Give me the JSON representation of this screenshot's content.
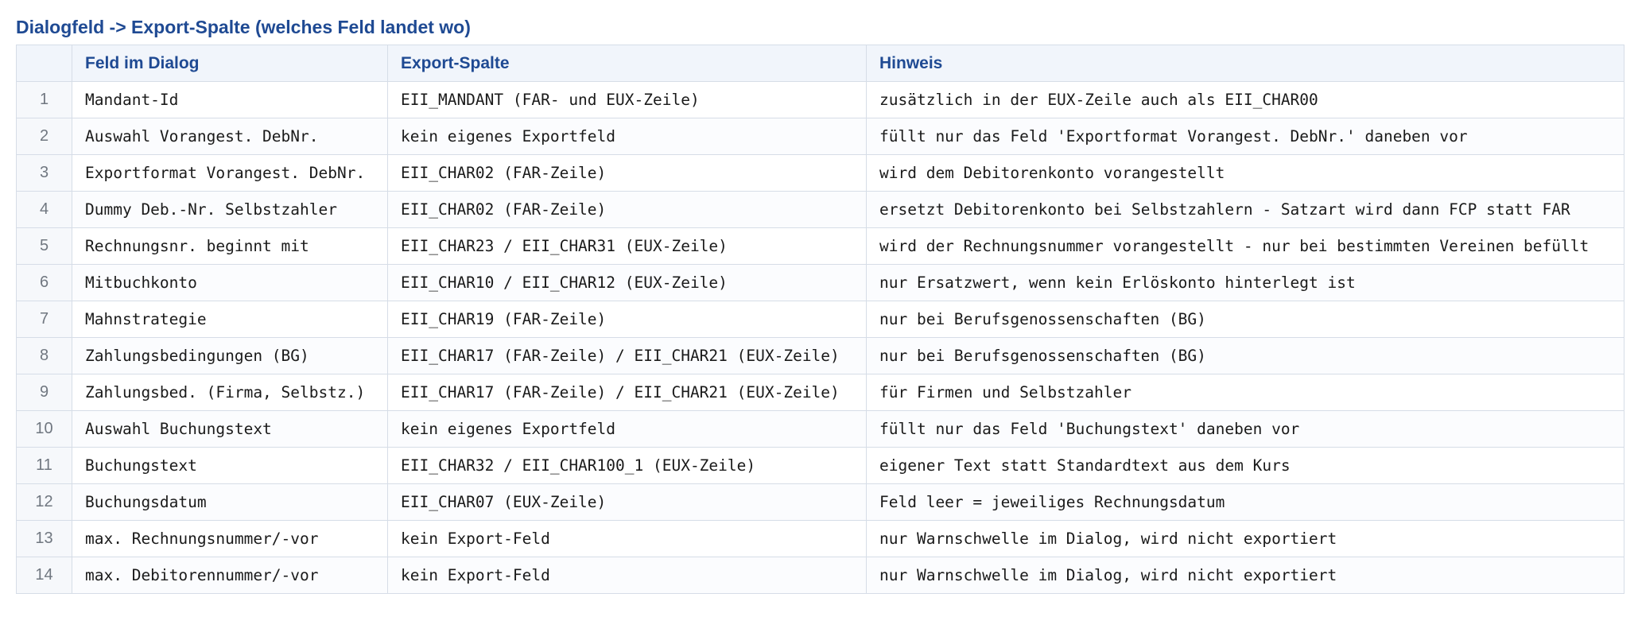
{
  "title": "Dialogfeld -> Export-Spalte (welches Feld landet wo)",
  "columns": [
    "",
    "Feld im Dialog",
    "Export-Spalte",
    "Hinweis"
  ],
  "rows": [
    {
      "num": "1",
      "field": "Mandant-Id",
      "export": "EII_MANDANT (FAR- und EUX-Zeile)",
      "note": "zusätzlich in der EUX-Zeile auch als EII_CHAR00"
    },
    {
      "num": "2",
      "field": "Auswahl Vorangest. DebNr.",
      "export": "kein eigenes Exportfeld",
      "note": "füllt nur das Feld 'Exportformat Vorangest. DebNr.' daneben vor"
    },
    {
      "num": "3",
      "field": "Exportformat Vorangest. DebNr.",
      "export": "EII_CHAR02 (FAR-Zeile)",
      "note": "wird dem Debitorenkonto vorangestellt"
    },
    {
      "num": "4",
      "field": "Dummy Deb.-Nr. Selbstzahler",
      "export": "EII_CHAR02 (FAR-Zeile)",
      "note": "ersetzt Debitorenkonto bei Selbstzahlern - Satzart wird dann FCP statt FAR"
    },
    {
      "num": "5",
      "field": "Rechnungsnr. beginnt mit",
      "export": "EII_CHAR23 / EII_CHAR31 (EUX-Zeile)",
      "note": "wird der Rechnungsnummer vorangestellt - nur bei bestimmten Vereinen befüllt"
    },
    {
      "num": "6",
      "field": "Mitbuchkonto",
      "export": "EII_CHAR10 / EII_CHAR12 (EUX-Zeile)",
      "note": "nur Ersatzwert, wenn kein Erlöskonto hinterlegt ist"
    },
    {
      "num": "7",
      "field": "Mahnstrategie",
      "export": "EII_CHAR19 (FAR-Zeile)",
      "note": "nur bei Berufsgenossenschaften (BG)"
    },
    {
      "num": "8",
      "field": "Zahlungsbedingungen (BG)",
      "export": "EII_CHAR17 (FAR-Zeile) / EII_CHAR21 (EUX-Zeile)",
      "note": "nur bei Berufsgenossenschaften (BG)"
    },
    {
      "num": "9",
      "field": "Zahlungsbed. (Firma, Selbstz.)",
      "export": "EII_CHAR17 (FAR-Zeile) / EII_CHAR21 (EUX-Zeile)",
      "note": "für Firmen und Selbstzahler"
    },
    {
      "num": "10",
      "field": "Auswahl Buchungstext",
      "export": "kein eigenes Exportfeld",
      "note": "füllt nur das Feld 'Buchungstext' daneben vor"
    },
    {
      "num": "11",
      "field": "Buchungstext",
      "export": "EII_CHAR32 / EII_CHAR100_1 (EUX-Zeile)",
      "note": "eigener Text statt Standardtext aus dem Kurs"
    },
    {
      "num": "12",
      "field": "Buchungsdatum",
      "export": "EII_CHAR07 (EUX-Zeile)",
      "note": "Feld leer = jeweiliges Rechnungsdatum"
    },
    {
      "num": "13",
      "field": "max. Rechnungsnummer/-vor",
      "export": "kein Export-Feld",
      "note": "nur Warnschwelle im Dialog, wird nicht exportiert"
    },
    {
      "num": "14",
      "field": "max. Debitorennummer/-vor",
      "export": "kein Export-Feld",
      "note": "nur Warnschwelle im Dialog, wird nicht exportiert"
    }
  ]
}
